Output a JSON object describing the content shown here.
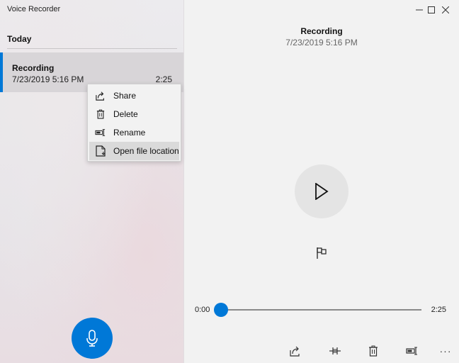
{
  "window": {
    "title": "Voice Recorder",
    "minimize_icon": "minimize-icon",
    "maximize_icon": "maximize-icon",
    "close_icon": "close-icon"
  },
  "sidebar": {
    "section_label": "Today",
    "recordings": [
      {
        "name": "Recording",
        "date": "7/23/2019 5:16 PM",
        "duration": "2:25",
        "selected": true
      }
    ],
    "record_button_icon": "microphone-icon"
  },
  "context_menu": {
    "items": [
      {
        "label": "Share",
        "icon": "share-icon"
      },
      {
        "label": "Delete",
        "icon": "trash-icon"
      },
      {
        "label": "Rename",
        "icon": "rename-icon"
      },
      {
        "label": "Open file location",
        "icon": "file-location-icon",
        "hovered": true
      }
    ]
  },
  "player": {
    "title": "Recording",
    "date": "7/23/2019 5:16 PM",
    "play_icon": "play-icon",
    "marker_icon": "flag-icon",
    "position": "0:00",
    "duration": "2:25",
    "progress_fraction": 0.0,
    "accent_color": "#0078d7"
  },
  "toolbar": {
    "items": [
      {
        "name": "share",
        "icon": "share-icon"
      },
      {
        "name": "trim",
        "icon": "trim-icon"
      },
      {
        "name": "delete",
        "icon": "trash-icon"
      },
      {
        "name": "rename",
        "icon": "rename-icon"
      },
      {
        "name": "more",
        "icon": "more-icon",
        "glyph": "···"
      }
    ]
  }
}
